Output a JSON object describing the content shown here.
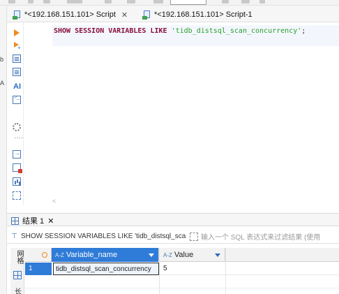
{
  "tabs": [
    {
      "label": "*<192.168.151.101> Script",
      "close": "✕"
    },
    {
      "label": "*<192.168.151.101> Script-1"
    }
  ],
  "editor": {
    "sql": {
      "kw1": "SHOW SESSION VARIABLES LIKE",
      "literal": "'tidb_distsql_scan_concurrency'",
      "end": ";"
    }
  },
  "left_strip": {
    "chars": [
      "b",
      "A"
    ]
  },
  "results": {
    "tab_label": "结果 1",
    "tab_close": "✕",
    "query_text": "SHOW SESSION VARIABLES LIKE 'tidb_distsql_sca",
    "filter_placeholder": "输入一个 SQL 表达式来过滤结果 (使用",
    "side_label": "网格",
    "side_bottom": "长",
    "columns": [
      {
        "label": "Variable_name",
        "sort_icon": "A-Z"
      },
      {
        "label": "Value",
        "sort_icon": "A-Z"
      }
    ],
    "rows": [
      {
        "num": "1",
        "Variable_name": "tidb_distsql_scan_concurrency",
        "Value": "5"
      }
    ]
  },
  "colors": {
    "accent": "#2f7bd8",
    "keyword": "#8b0f3a",
    "string": "#2a9d2a",
    "run": "#f08a1c"
  },
  "icons": [
    "sql-script-icon",
    "close-icon",
    "run-statement-icon",
    "run-script-icon",
    "explain-icon",
    "format-icon",
    "ai-icon",
    "terminal-icon",
    "settings-icon",
    "more-icon",
    "import-icon",
    "lock-icon",
    "statistics-icon",
    "grid-icon",
    "expand-icon",
    "dropdown-icon"
  ]
}
